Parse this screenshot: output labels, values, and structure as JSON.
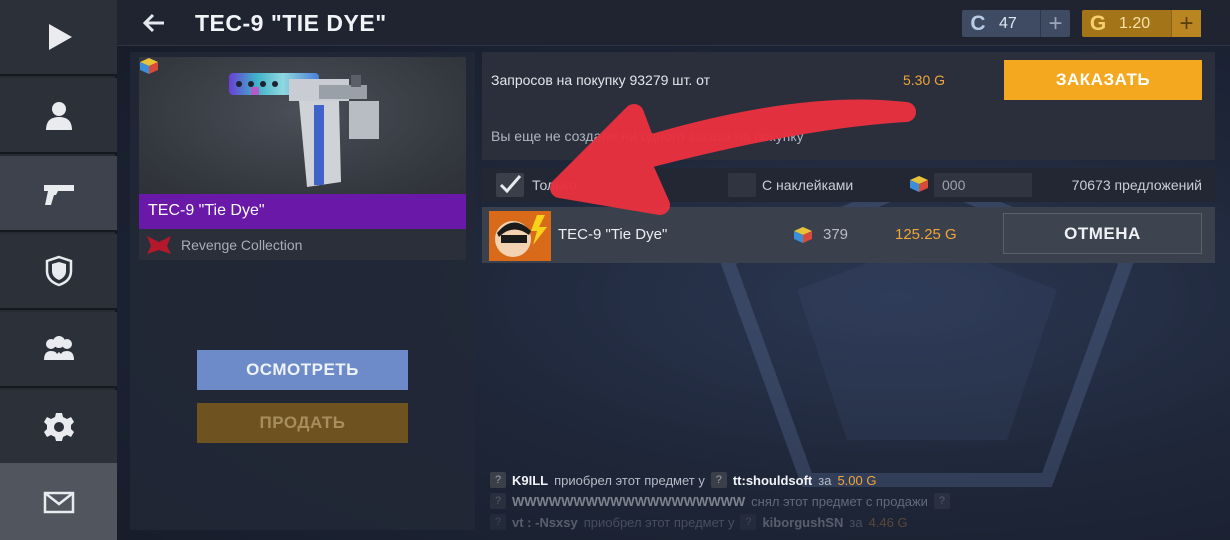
{
  "header": {
    "title": "TEC-9 \"TIE DYE\"",
    "silver_currency": {
      "icon": "C",
      "value": "47"
    },
    "gold_currency": {
      "icon": "G",
      "value": "1.20"
    },
    "plus": "+"
  },
  "sidebar": {
    "items": [
      {
        "icon": "play-icon"
      },
      {
        "icon": "profile-icon"
      },
      {
        "icon": "pistol-icon",
        "active": true
      },
      {
        "icon": "clan-shield-icon"
      },
      {
        "icon": "friends-icon"
      },
      {
        "icon": "gear-icon"
      },
      {
        "icon": "mail-icon"
      }
    ]
  },
  "item": {
    "name": "TEC-9 \"Tie Dye\"",
    "collection": "Revenge Collection",
    "rarity_color": "#6a18a8",
    "inspect_label": "ОСМОТРЕТЬ",
    "sell_label": "ПРОДАТЬ"
  },
  "buy_requests": {
    "text": "Запросов на покупку 93279 шт. от",
    "price": "5.30 G",
    "order_label": "ЗАКАЗАТЬ",
    "no_orders_text": "Вы еще не создали ни одного заказа на покупку"
  },
  "filters": {
    "only_label": "Только",
    "stickers_label": "С наклейками",
    "pattern_value": "000",
    "offers_count": "70673 предложений"
  },
  "listing": {
    "name": "TEC-9 \"Tie Dye\"",
    "pattern": "379",
    "price": "125.25 G",
    "cancel_label": "ОТМЕНА"
  },
  "feed": [
    {
      "buyer": "K9ILL",
      "action": "приобрел этот предмет у",
      "seller": "tt:shouldsoft",
      "suffix": "за",
      "price": "5.00 G"
    },
    {
      "buyer": "WWWWWWWWWWWWWWWWWWW",
      "action": "снял этот предмет с продажи"
    },
    {
      "buyer": "vt : -Nsxsy",
      "action": "приобрел этот предмет у",
      "seller": "kiborgushSN",
      "suffix": "за",
      "price": "4.46 G"
    }
  ],
  "accent_colors": {
    "gold": "#f4a81f",
    "price": "#f0a53a",
    "annotation_arrow": "#e8313f"
  }
}
